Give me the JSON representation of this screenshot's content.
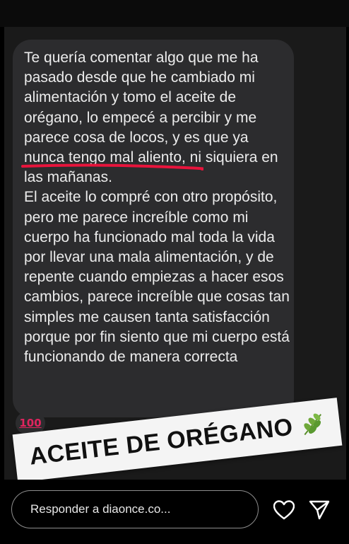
{
  "message": {
    "paragraph1_before": "Te quería comentar algo que me ha pasado desde que he cambiado mi alimentación y tomo el aceite de orégano, lo empecé a percibir y me parece cosa de locos, y es que ya ",
    "paragraph1_highlight": "nunca tengo mal aliento",
    "paragraph1_after": ", ni siquiera en las mañanas.",
    "paragraph2": "El aceite lo compré con otro propósito, pero me parece increíble como mi cuerpo ha funcionado mal toda la vida por llevar una mala alimentación, y de repente cuando empiezas a hacer esos cambios, parece increíble que cosas tan simples me causen tanta satisfacción porque por fin siento que mi cuerpo está funcionando de manera correcta"
  },
  "reaction": {
    "emoji": "100"
  },
  "sticker": {
    "text": "ACEITE DE ORÉGANO",
    "icon": "herb-leaf-icon"
  },
  "reply_bar": {
    "placeholder": "Responder a diaonce.co..."
  },
  "actions": {
    "like_icon": "heart-icon",
    "share_icon": "send-icon"
  },
  "colors": {
    "highlight_underline": "#e8143c",
    "bubble": "#2c2c2e"
  }
}
